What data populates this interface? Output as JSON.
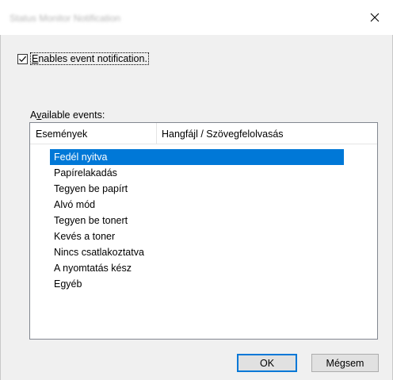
{
  "window": {
    "title": "Status Monitor Notification"
  },
  "notification": {
    "label_accel": "E",
    "label_rest": "nables event notification.",
    "checked": true
  },
  "events": {
    "label_pre": "A",
    "label_accel": "v",
    "label_rest": "ailable events:",
    "columns": [
      "Események",
      "Hangfájl / Szövegfelolvasás"
    ],
    "rows": [
      "Fedél nyitva",
      "Papírelakadás",
      "Tegyen be papírt",
      "Alvó mód",
      "Tegyen be tonert",
      "Kevés a toner",
      "Nincs csatlakoztatva",
      "A nyomtatás kész",
      "Egyéb"
    ],
    "selected_index": 0
  },
  "buttons": {
    "ok": "OK",
    "cancel": "Mégsem"
  },
  "colors": {
    "selection": "#0078d7",
    "background": "#f0f0f0"
  }
}
